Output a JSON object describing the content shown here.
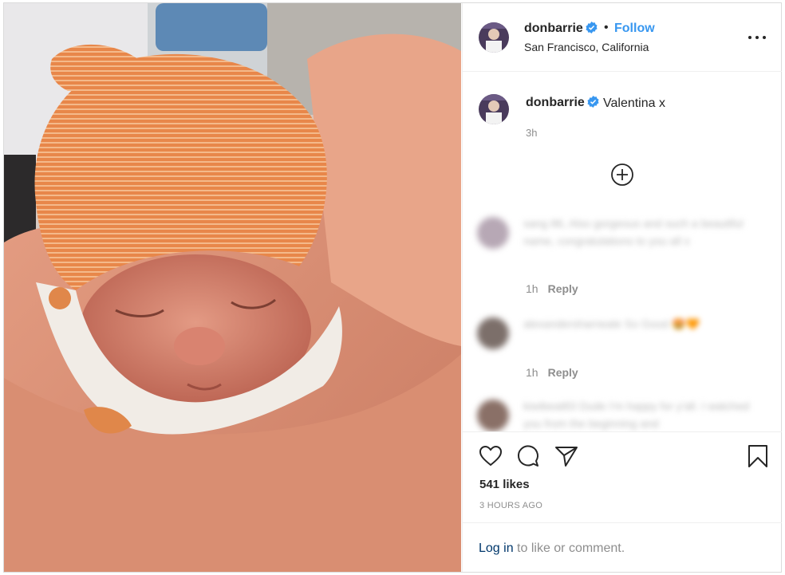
{
  "header": {
    "username": "donbarrie",
    "separator": "•",
    "follow_label": "Follow",
    "location": "San Francisco, California"
  },
  "caption": {
    "username": "donbarrie",
    "text": "Valentina x",
    "time": "3h"
  },
  "comments": [
    {
      "text": "sang 86, Also gorgeous and such a beautiful name, congratulations to you all x",
      "time": "1h",
      "reply_label": "Reply",
      "avatar_color": "#b7a8b5"
    },
    {
      "text": "alexandersharneale So Good 🤩🧡",
      "time": "1h",
      "reply_label": "Reply",
      "avatar_color": "#7c6f6a"
    },
    {
      "text": "kiwibeat83 Dude I'm happy for y'all. I watched you from the beginning and",
      "time": "",
      "reply_label": "",
      "avatar_color": "#8a7067"
    }
  ],
  "post": {
    "likes": "541 likes",
    "time_ago": "3 HOURS AGO"
  },
  "login": {
    "link": "Log in",
    "suffix": " to like or comment."
  },
  "icons": [
    "verified-badge-icon",
    "more-options-icon",
    "add-circle-icon",
    "heart-icon",
    "comment-icon",
    "share-icon",
    "bookmark-icon"
  ],
  "colors": {
    "accent": "#3897f0",
    "muted": "#8e8e8e",
    "border": "#dbdbdb"
  }
}
